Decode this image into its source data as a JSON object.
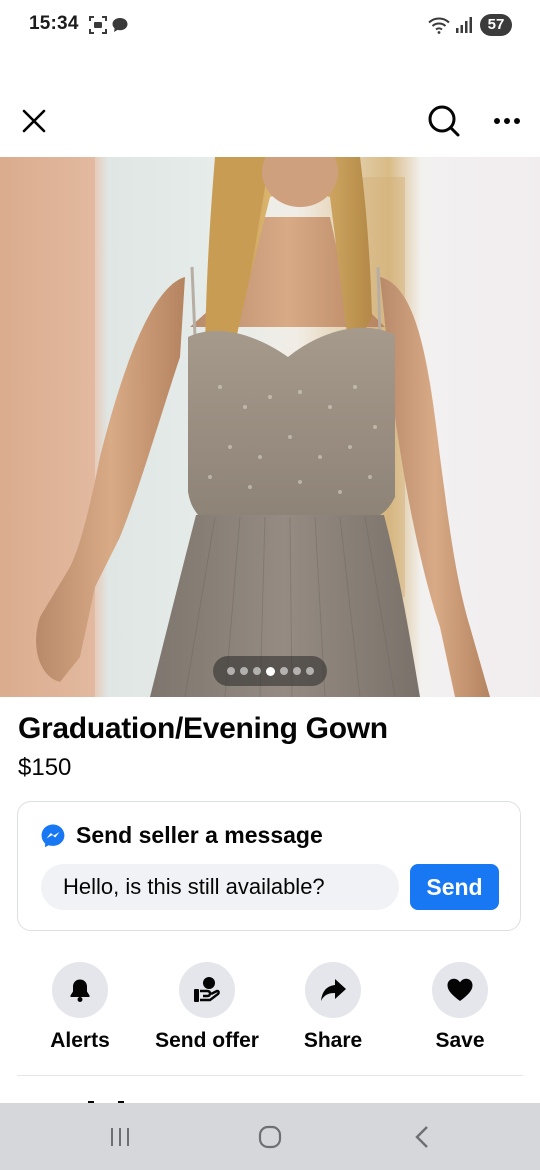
{
  "status_bar": {
    "time": "15:34",
    "battery": "57"
  },
  "top_bar": {
    "close_icon": "close-icon",
    "search_icon": "search-icon",
    "more_icon": "more-options-icon"
  },
  "image": {
    "carousel_total": 7,
    "carousel_active_index": 3
  },
  "listing": {
    "title": "Graduation/Evening Gown",
    "price": "$150"
  },
  "message": {
    "heading": "Send seller a message",
    "input_value": "Hello, is this still available?",
    "send_label": "Send",
    "accent_color": "#1877f2"
  },
  "actions": [
    {
      "label": "Alerts",
      "icon": "bell-icon"
    },
    {
      "label": "Send offer",
      "icon": "offer-icon"
    },
    {
      "label": "Share",
      "icon": "share-arrow-icon"
    },
    {
      "label": "Save",
      "icon": "heart-icon"
    }
  ],
  "nav": {
    "recent_icon": "recent-apps-icon",
    "home_icon": "home-icon",
    "back_icon": "back-icon"
  }
}
